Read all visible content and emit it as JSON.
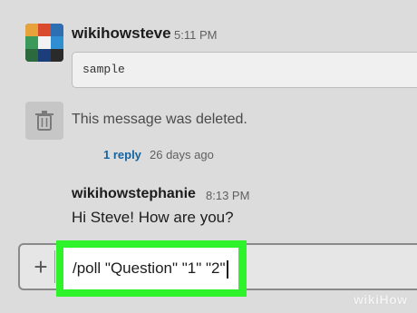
{
  "messages": [
    {
      "username": "wikihowsteve",
      "time": "5:11 PM",
      "code": "sample"
    },
    {
      "deleted_text": "This message was deleted."
    }
  ],
  "thread": {
    "reply_label": "1 reply",
    "reply_time": "26 days ago"
  },
  "message3": {
    "username": "wikihowstephanie",
    "time": "8:13 PM",
    "text": "Hi Steve! How are you?"
  },
  "composer": {
    "plus_label": "+",
    "value": "/poll \"Question\" \"1\" \"2\""
  },
  "watermark": "wikiHow",
  "colors": {
    "highlight": "#2ef32a",
    "link": "#1264a3",
    "background": "#dcdcdc"
  },
  "icons": [
    "avatar",
    "trash-icon",
    "plus-icon"
  ]
}
